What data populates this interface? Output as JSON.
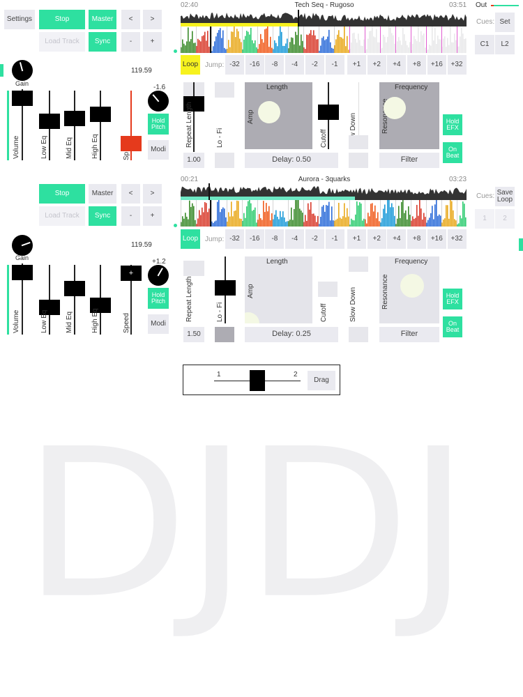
{
  "deck1": {
    "settings_label": "Settings",
    "stop_label": "Stop",
    "master_label": "Master",
    "prev_label": "<",
    "next_label": ">",
    "load_track_label": "Load Track",
    "sync_label": "Sync",
    "minus_label": "-",
    "plus_label": "+",
    "gain_label": "Gain",
    "bpm": "119.59",
    "pitch_value": "-1.6",
    "volume_label": "Volume",
    "low_eq_label": "Low Eq",
    "mid_eq_label": "Mid Eq",
    "high_eq_label": "High Eq",
    "speed_label": "Sp",
    "hold_pitch_label": "Hold Pitch",
    "modi_label": "Modi",
    "time_elapsed": "02:40",
    "track_title": "Tech Seq - Rugoso",
    "time_total": "03:51",
    "out_label": "Out",
    "cues_label": "Cues:",
    "set_label": "Set",
    "cue_c1": "C1",
    "cue_l2": "L2",
    "loop_label": "Loop",
    "jump_label": "Jump:",
    "jumps_back": [
      "-32",
      "-16",
      "-8",
      "-4",
      "-2",
      "-1"
    ],
    "jumps_fwd": [
      "+1",
      "+2",
      "+4",
      "+8",
      "+16",
      "+32"
    ],
    "repeat_label": "Repeat Length",
    "repeat_value": "1.00",
    "lofi_label": "Lo - Fi",
    "length_label": "Length",
    "amp_label": "Amp",
    "delay_label": "Delay: 0.50",
    "cutoff_label": "Cutoff",
    "slow_down_label": "Slow Down",
    "frequency_label": "Frequency",
    "resonance_label": "Resonance",
    "filter_label": "Filter",
    "hold_efx_label": "Hold EFX",
    "on_beat_label": "On Beat"
  },
  "deck2": {
    "stop_label": "Stop",
    "master_label": "Master",
    "prev_label": "<",
    "next_label": ">",
    "load_track_label": "Load Track",
    "sync_label": "Sync",
    "minus_label": "-",
    "plus_label": "+",
    "gain_label": "Gain",
    "bpm": "119.59",
    "pitch_value": "+1.2",
    "volume_label": "Volume",
    "low_eq_label": "Low Eq",
    "mid_eq_label": "Mid Eq",
    "high_eq_label": "High Eq",
    "speed_label": "Speed",
    "speed_plus": "+",
    "hold_pitch_label": "Hold Pitch",
    "modi_label": "Modi",
    "time_elapsed": "00:21",
    "track_title": "Aurora - 3quarks",
    "time_total": "03:23",
    "cues_label": "Cues:",
    "save_loop_label": "Save Loop",
    "cue_1": "1",
    "cue_2": "2",
    "loop_label": "Loop",
    "jump_label": "Jump:",
    "jumps_back": [
      "-32",
      "-16",
      "-8",
      "-4",
      "-2",
      "-1"
    ],
    "jumps_fwd": [
      "+1",
      "+2",
      "+4",
      "+8",
      "+16",
      "+32"
    ],
    "repeat_label": "Repeat Length",
    "repeat_value": "1.50",
    "lofi_label": "Lo - Fi",
    "length_label": "Length",
    "amp_label": "Amp",
    "delay_label": "Delay: 0.25",
    "cutoff_label": "Cutoff",
    "slow_down_label": "Slow Down",
    "frequency_label": "Frequency",
    "resonance_label": "Resonance",
    "filter_label": "Filter",
    "hold_efx_label": "Hold EFX",
    "on_beat_label": "On Beat"
  },
  "crossfader": {
    "left_label": "1",
    "right_label": "2",
    "drag_label": "Drag",
    "value": 0.5
  },
  "logo": "DJDJ",
  "colors": {
    "accent": "#2ee0a0",
    "highlight": "#f7f21e",
    "speed_red": "#e53a1c",
    "button_bg": "#eaeaf0",
    "pad_gray": "#adacb3"
  }
}
